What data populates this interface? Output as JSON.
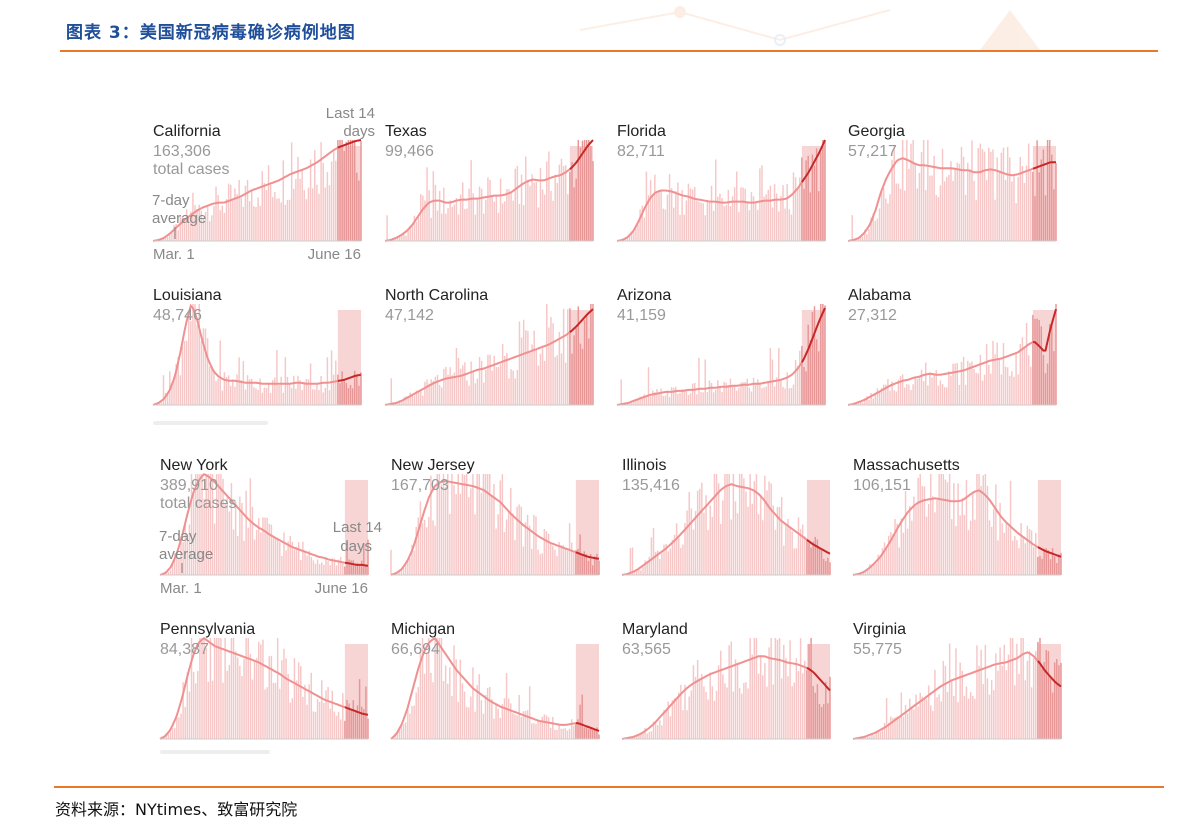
{
  "figure": {
    "title": "图表 3：美国新冠病毒确诊病例地图",
    "source": "资料来源：NYtimes、致富研究院"
  },
  "colors": {
    "title": "#1f4e9a",
    "rule": "#e8792b",
    "bar": "#f7c6c6",
    "bar_recent": "#e79595",
    "recent_band": "#f2b3b3",
    "line": "#f09090",
    "line_recent": "#c62828",
    "count_text": "#999999"
  },
  "annotations": {
    "last14_line1": "Last 14",
    "last14_line2": "days",
    "total_cases": "total cases",
    "avg_line1": "7-day",
    "avg_line2": "average",
    "start_date": "Mar. 1",
    "end_date": "June 16"
  },
  "chart_data": [
    {
      "type": "area",
      "state": "California",
      "total": "163,306",
      "average_curve": [
        0,
        1,
        3,
        7,
        12,
        17,
        22,
        26,
        30,
        33,
        35,
        37,
        38,
        38,
        40,
        42,
        44,
        47,
        50,
        52,
        54,
        56,
        58,
        60,
        63,
        66,
        68,
        70,
        72,
        75,
        78,
        82,
        86,
        90,
        93,
        95,
        97,
        99,
        100
      ]
    },
    {
      "type": "area",
      "state": "Texas",
      "total": "99,466",
      "average_curve": [
        0,
        1,
        3,
        6,
        10,
        16,
        24,
        32,
        38,
        40,
        40,
        38,
        38,
        40,
        41,
        41,
        42,
        42,
        43,
        44,
        45,
        45,
        46,
        48,
        52,
        56,
        59,
        61,
        60,
        60,
        62,
        64,
        65,
        68,
        72,
        78,
        86,
        94,
        100
      ]
    },
    {
      "type": "area",
      "state": "Florida",
      "total": "82,711",
      "average_curve": [
        0,
        1,
        4,
        10,
        20,
        32,
        42,
        48,
        50,
        50,
        49,
        47,
        45,
        44,
        42,
        41,
        40,
        39,
        39,
        38,
        38,
        39,
        39,
        39,
        38,
        38,
        39,
        40,
        40,
        41,
        41,
        42,
        46,
        52,
        60,
        68,
        78,
        88,
        100
      ]
    },
    {
      "type": "area",
      "state": "Georgia",
      "total": "57,217",
      "average_curve": [
        0,
        1,
        3,
        8,
        16,
        30,
        48,
        62,
        72,
        80,
        82,
        80,
        77,
        75,
        75,
        74,
        73,
        72,
        72,
        72,
        71,
        70,
        70,
        68,
        68,
        70,
        71,
        70,
        68,
        66,
        65,
        66,
        68,
        70,
        72,
        74,
        76,
        78,
        78
      ]
    },
    {
      "type": "area",
      "state": "Louisiana",
      "total": "48,746",
      "average_curve": [
        0,
        2,
        6,
        14,
        28,
        52,
        80,
        100,
        86,
        64,
        46,
        34,
        28,
        25,
        24,
        24,
        23,
        22,
        22,
        22,
        21,
        21,
        21,
        21,
        21,
        21,
        22,
        22,
        21,
        21,
        21,
        22,
        22,
        23,
        24,
        25,
        27,
        29,
        30
      ]
    },
    {
      "type": "area",
      "state": "North Carolina",
      "total": "47,142",
      "average_curve": [
        0,
        1,
        2,
        4,
        7,
        10,
        13,
        16,
        19,
        22,
        24,
        26,
        27,
        28,
        29,
        31,
        33,
        35,
        36,
        38,
        40,
        42,
        44,
        46,
        48,
        50,
        52,
        54,
        56,
        58,
        60,
        63,
        66,
        69,
        73,
        78,
        84,
        90,
        95
      ]
    },
    {
      "type": "area",
      "state": "Arizona",
      "total": "41,159",
      "average_curve": [
        0,
        1,
        2,
        4,
        6,
        8,
        10,
        11,
        12,
        13,
        13,
        14,
        14,
        15,
        15,
        16,
        16,
        17,
        17,
        18,
        18,
        19,
        19,
        20,
        20,
        21,
        21,
        22,
        23,
        24,
        25,
        27,
        30,
        36,
        44,
        56,
        70,
        84,
        96
      ]
    },
    {
      "type": "area",
      "state": "Alabama",
      "total": "27,312",
      "average_curve": [
        0,
        1,
        3,
        5,
        8,
        11,
        14,
        17,
        20,
        22,
        24,
        25,
        27,
        28,
        30,
        31,
        30,
        30,
        31,
        32,
        33,
        34,
        36,
        38,
        40,
        42,
        44,
        45,
        46,
        48,
        50,
        52,
        56,
        60,
        63,
        58,
        52,
        76,
        95
      ]
    },
    {
      "type": "area",
      "state": "New York",
      "total": "389,910",
      "average_curve": [
        0,
        2,
        8,
        20,
        38,
        60,
        80,
        93,
        100,
        97,
        92,
        86,
        80,
        74,
        68,
        62,
        56,
        51,
        47,
        44,
        40,
        37,
        34,
        31,
        28,
        26,
        24,
        22,
        20,
        18,
        17,
        15,
        14,
        13,
        12,
        11,
        10,
        10,
        9
      ]
    },
    {
      "type": "area",
      "state": "New Jersey",
      "total": "167,703",
      "average_curve": [
        0,
        2,
        6,
        14,
        26,
        44,
        62,
        78,
        88,
        92,
        93,
        92,
        91,
        90,
        89,
        88,
        86,
        84,
        80,
        76,
        72,
        66,
        60,
        55,
        50,
        46,
        42,
        38,
        35,
        32,
        30,
        28,
        26,
        24,
        22,
        20,
        18,
        17,
        16
      ]
    },
    {
      "type": "area",
      "state": "Illinois",
      "total": "135,416",
      "average_curve": [
        0,
        1,
        3,
        6,
        10,
        14,
        18,
        22,
        26,
        31,
        36,
        42,
        48,
        54,
        60,
        66,
        72,
        78,
        84,
        88,
        90,
        88,
        87,
        86,
        84,
        80,
        74,
        66,
        60,
        54,
        50,
        46,
        42,
        38,
        34,
        30,
        27,
        24,
        21
      ]
    },
    {
      "type": "area",
      "state": "Massachusetts",
      "total": "106,151",
      "average_curve": [
        0,
        1,
        3,
        7,
        12,
        18,
        26,
        35,
        45,
        54,
        62,
        68,
        72,
        74,
        75,
        76,
        75,
        74,
        73,
        73,
        74,
        78,
        82,
        84,
        80,
        74,
        66,
        58,
        52,
        47,
        42,
        38,
        34,
        30,
        27,
        24,
        22,
        20,
        18
      ]
    },
    {
      "type": "area",
      "state": "Pennsylvania",
      "total": "84,387",
      "average_curve": [
        0,
        3,
        10,
        22,
        40,
        62,
        82,
        95,
        100,
        96,
        92,
        90,
        88,
        86,
        84,
        82,
        80,
        78,
        76,
        73,
        70,
        67,
        64,
        60,
        57,
        54,
        51,
        48,
        45,
        42,
        39,
        37,
        35,
        33,
        31,
        29,
        27,
        25,
        24
      ]
    },
    {
      "type": "area",
      "state": "Michigan",
      "total": "66,694",
      "average_curve": [
        0,
        5,
        15,
        30,
        50,
        70,
        86,
        96,
        100,
        92,
        84,
        76,
        68,
        62,
        56,
        50,
        46,
        42,
        38,
        35,
        32,
        30,
        28,
        26,
        24,
        22,
        20,
        18,
        17,
        16,
        15,
        14,
        14,
        15,
        16,
        14,
        12,
        10,
        8
      ]
    },
    {
      "type": "area",
      "state": "Maryland",
      "total": "63,565",
      "average_curve": [
        0,
        1,
        2,
        4,
        7,
        11,
        16,
        22,
        28,
        34,
        40,
        46,
        51,
        55,
        58,
        61,
        64,
        66,
        68,
        70,
        72,
        74,
        76,
        78,
        80,
        82,
        82,
        80,
        79,
        78,
        76,
        75,
        74,
        72,
        70,
        66,
        60,
        54,
        48
      ]
    },
    {
      "type": "area",
      "state": "Virginia",
      "total": "55,775",
      "average_curve": [
        0,
        1,
        2,
        4,
        6,
        9,
        12,
        16,
        20,
        24,
        28,
        32,
        36,
        40,
        44,
        48,
        52,
        55,
        58,
        60,
        62,
        64,
        66,
        68,
        70,
        72,
        74,
        75,
        76,
        78,
        80,
        84,
        86,
        82,
        76,
        68,
        62,
        56,
        52
      ]
    }
  ]
}
